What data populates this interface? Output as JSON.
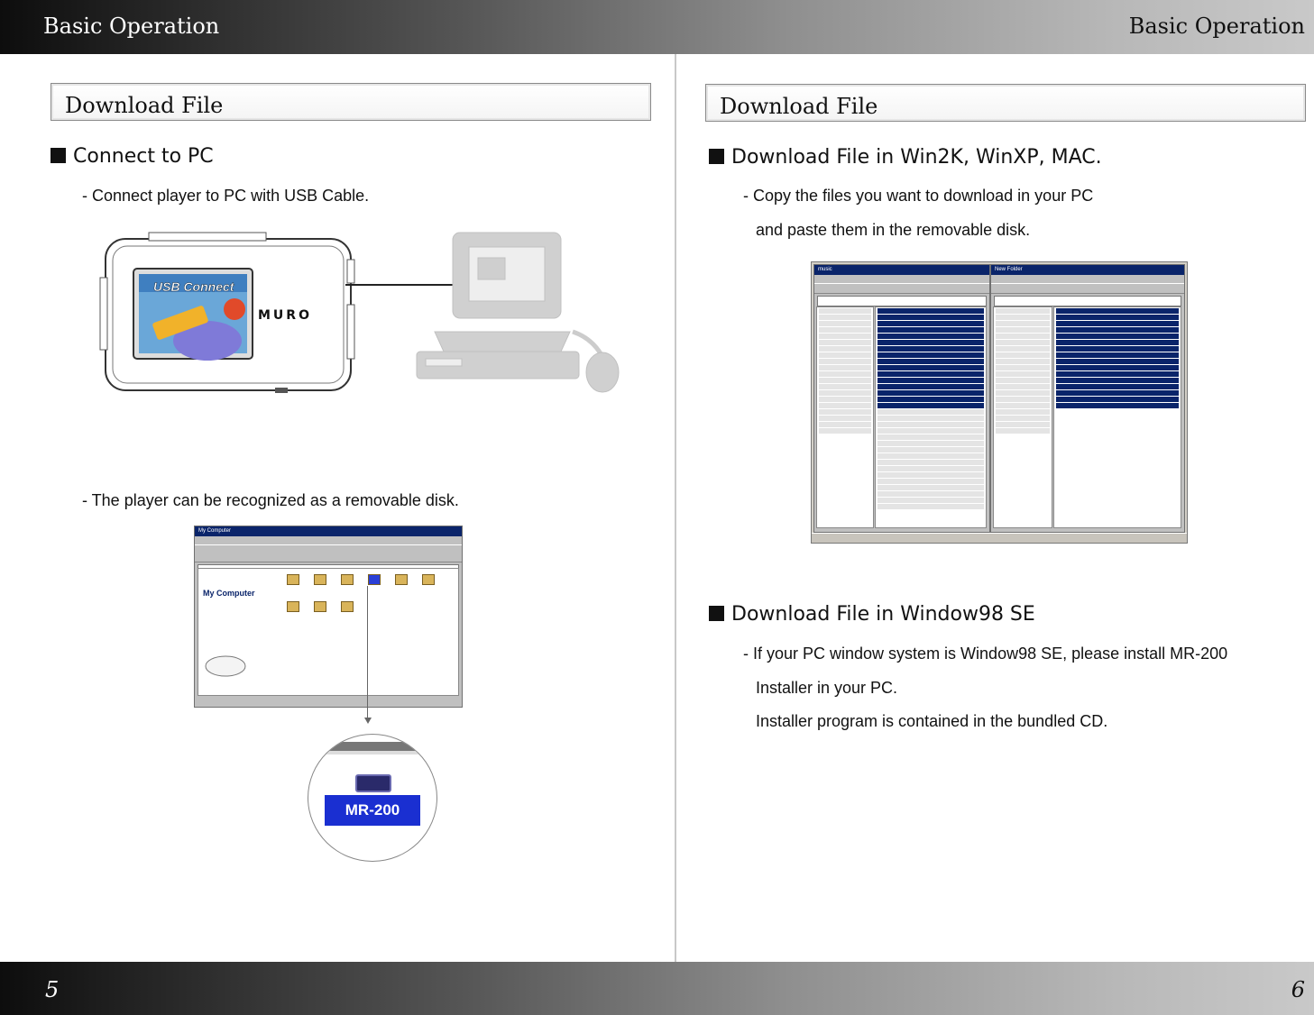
{
  "header": {
    "left_title": "Basic Operation",
    "right_title": "Basic Operation"
  },
  "footer": {
    "left_page": "5",
    "right_page": "6"
  },
  "left": {
    "section_title": "Download File",
    "heading": "Connect to PC",
    "line1": "- Connect player to PC with USB Cable.",
    "line2": "- The player can be recognized as a removable disk.",
    "device_screen_text": "USB Connect",
    "device_brand": "MURO",
    "window_title": "My Computer",
    "window_heading": "My Computer",
    "callout_label": "MR-200"
  },
  "right": {
    "section_title": "Download File",
    "heading1": "Download File in Win2K, WinXP, MAC.",
    "line1": "- Copy the files you want to download in your PC",
    "line2": "and paste them in the removable disk.",
    "heading2": "Download File in Window98 SE",
    "line3": "- If your PC window system is Window98 SE, please install MR-200",
    "line4": "Installer in your PC.",
    "line5": "Installer program is contained in the bundled CD.",
    "left_window_title": "music",
    "right_window_title": "New Folder"
  },
  "colors": {
    "callout_bg": "#1a2fd1",
    "window_title_bar": "#0a246a"
  }
}
